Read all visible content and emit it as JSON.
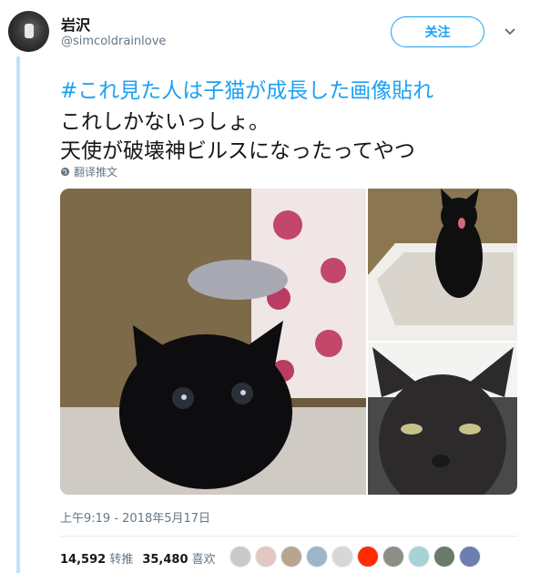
{
  "user": {
    "name": "岩沢",
    "handle": "@simcoldrainlove"
  },
  "follow_label": "关注",
  "tweet": {
    "line1": "#これ見た人は子猫が成長した画像貼れ",
    "line2": "これしかないっしょ。",
    "line3": "天使が破壊神ビルスになったってやつ"
  },
  "translate_label": "翻译推文",
  "timestamp": "上午9:19 - 2018年5月17日",
  "stats": {
    "retweets": "14,592",
    "retweets_label": "转推",
    "likes": "35,480",
    "likes_label": "喜欢"
  },
  "colors": {
    "accent": "#1da1f2",
    "muted": "#657786",
    "text": "#14171a"
  },
  "liker_avatars": [
    "#c9c9c9",
    "#e3c7c0",
    "#b7a58e",
    "#9bb5c9",
    "#d7d7d7",
    "#ff2a00",
    "#8e8e86",
    "#a7d3d6",
    "#6a7a6a",
    "#6d7fb0"
  ]
}
